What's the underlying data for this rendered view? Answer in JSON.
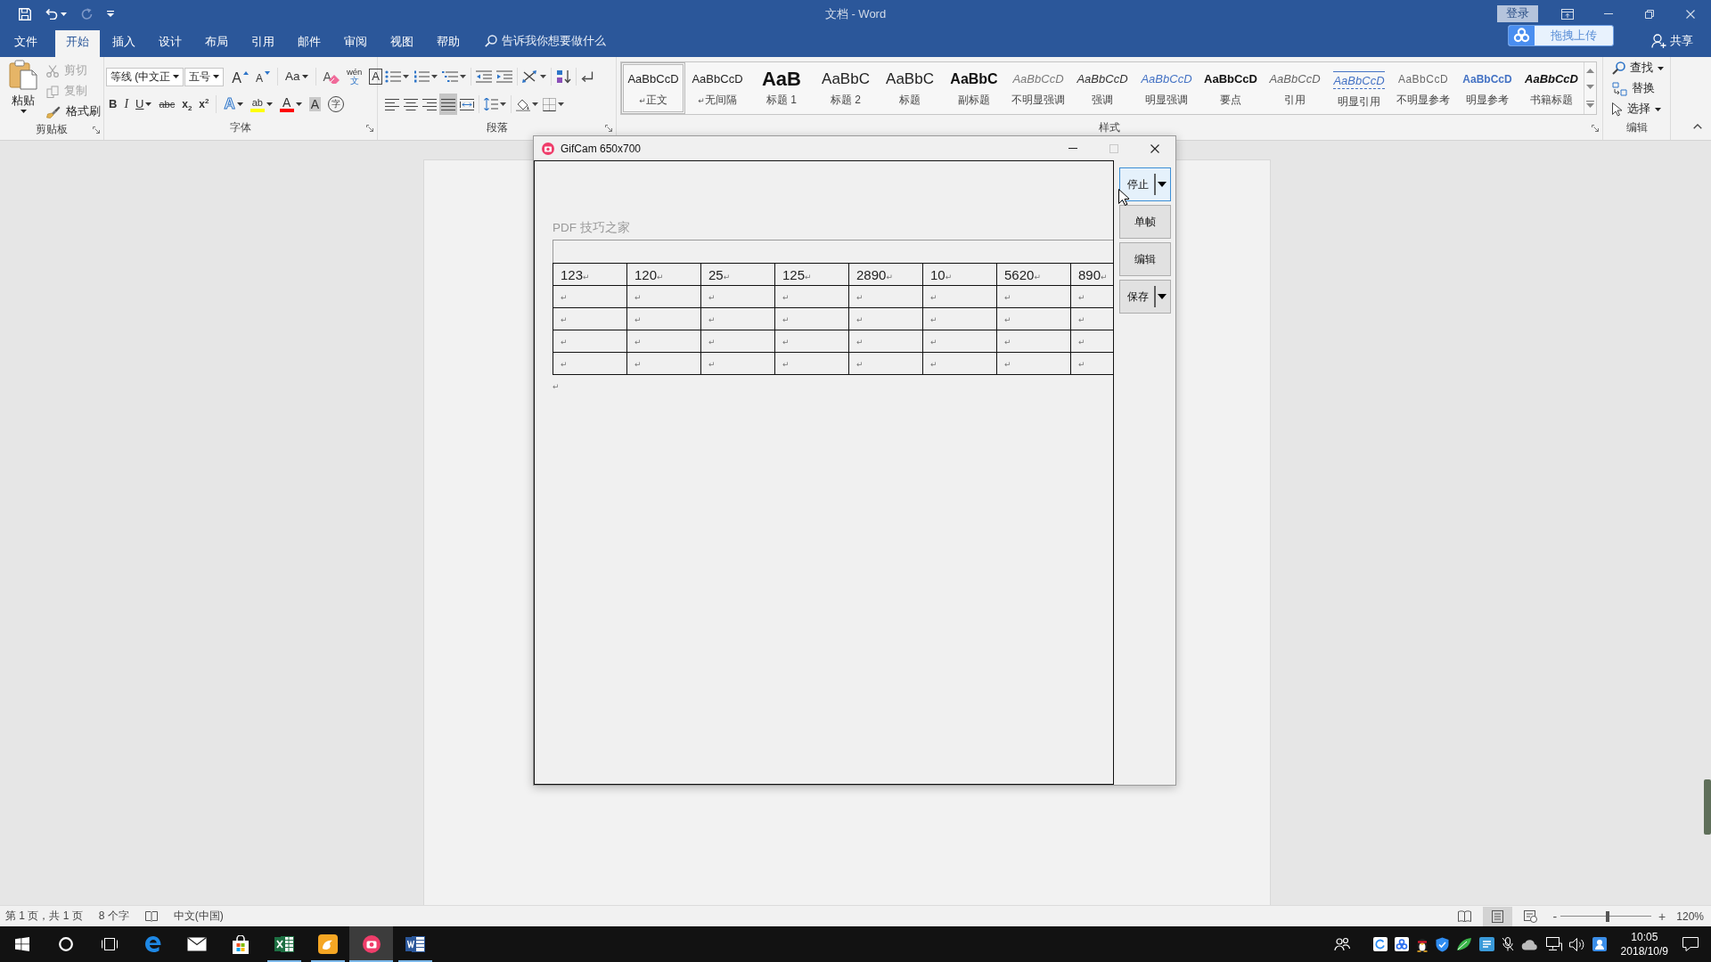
{
  "title_bar": {
    "quick_access": [
      {
        "kind": "save",
        "disabled": false,
        "dropdown": false
      },
      {
        "kind": "undo",
        "disabled": false,
        "dropdown": true
      },
      {
        "kind": "redo",
        "disabled": true,
        "dropdown": false
      },
      {
        "kind": "customize",
        "disabled": false,
        "dropdown": false
      }
    ],
    "title": "文档 - Word",
    "sign_in": "登录"
  },
  "menu_tabs": [
    {
      "label": "文件",
      "selected": false
    },
    {
      "label": "开始",
      "selected": true
    },
    {
      "label": "插入",
      "selected": false
    },
    {
      "label": "设计",
      "selected": false
    },
    {
      "label": "布局",
      "selected": false
    },
    {
      "label": "引用",
      "selected": false
    },
    {
      "label": "邮件",
      "selected": false
    },
    {
      "label": "审阅",
      "selected": false
    },
    {
      "label": "视图",
      "selected": false
    },
    {
      "label": "帮助",
      "selected": false
    }
  ],
  "tell_me": {
    "placeholder": "告诉我你想要做什么"
  },
  "upload_button": {
    "label": "拖拽上传"
  },
  "share_button": {
    "label": "共享"
  },
  "ribbon": {
    "clipboard": {
      "title": "剪贴板",
      "paste": "粘贴",
      "actions": [
        {
          "kind": "cut",
          "label": "剪切",
          "disabled": true
        },
        {
          "kind": "copy",
          "label": "复制",
          "disabled": true
        },
        {
          "kind": "format-painter",
          "label": "格式刷",
          "disabled": false
        }
      ]
    },
    "font": {
      "title": "字体",
      "font_name": "等线 (中文正",
      "font_size": "五号",
      "row_1": [
        {
          "kind": "grow",
          "label": "A",
          "dropdown": false
        },
        {
          "kind": "shrink",
          "label": "A",
          "dropdown": false
        },
        {
          "kind": "case",
          "label": "Aa",
          "dropdown": true
        },
        {
          "kind": "clear",
          "label": "A",
          "dropdown": false
        },
        {
          "kind": "phonetic",
          "label": "wén",
          "sub_label": "文",
          "dropdown": false
        },
        {
          "kind": "border",
          "label": "A",
          "dropdown": false
        }
      ],
      "row_2": [
        {
          "kind": "bold",
          "label": "B",
          "dropdown": false
        },
        {
          "kind": "italic",
          "label": "I",
          "dropdown": false
        },
        {
          "kind": "underline",
          "label": "U",
          "dropdown": true
        },
        {
          "kind": "strike",
          "label": "abc",
          "dropdown": false
        },
        {
          "kind": "subscript",
          "label": "x$_{2}$",
          "dropdown": false
        },
        {
          "kind": "superscript",
          "label": "x$^{2}$",
          "dropdown": false
        },
        {
          "kind": "effects",
          "label": "A",
          "dropdown": true
        },
        {
          "kind": "highlight",
          "label": "ab",
          "dropdown": true,
          "color": "#ffff00"
        },
        {
          "kind": "font-color",
          "label": "A",
          "dropdown": true,
          "color": "#ff0000"
        },
        {
          "kind": "shading",
          "label": "A",
          "dropdown": false
        },
        {
          "kind": "enclose",
          "label": "字",
          "dropdown": false
        }
      ]
    },
    "paragraph": {
      "title": "段落",
      "row_1": [
        {
          "kind": "bullets",
          "dropdown": true
        },
        {
          "kind": "numbering",
          "dropdown": true
        },
        {
          "kind": "multilevel",
          "dropdown": true
        },
        {
          "kind": "outdent",
          "dropdown": false
        },
        {
          "kind": "indent",
          "dropdown": false
        },
        {
          "kind": "asian-layout",
          "dropdown": true
        },
        {
          "kind": "sort",
          "dropdown": false
        },
        {
          "kind": "show-marks",
          "dropdown": false
        }
      ],
      "alignment": [
        {
          "kind": "align-left",
          "selected": false
        },
        {
          "kind": "align-center",
          "selected": false
        },
        {
          "kind": "align-right",
          "selected": false
        },
        {
          "kind": "justify",
          "selected": true
        },
        {
          "kind": "distributed",
          "selected": false
        }
      ],
      "row_2_tools": [
        {
          "kind": "line-spacing",
          "dropdown": true
        },
        {
          "kind": "para-shading",
          "dropdown": true
        },
        {
          "kind": "borders",
          "dropdown": true
        }
      ]
    },
    "styles": {
      "title": "样式",
      "items": [
        {
          "kind": "normal",
          "preview": "AaBbCcD",
          "name": "正文",
          "mark": "↵",
          "selected": true
        },
        {
          "kind": "normal",
          "preview": "AaBbCcD",
          "name": "无间隔",
          "mark": "↵",
          "selected": false
        },
        {
          "kind": "heading1",
          "preview": "AaB",
          "name": "标题 1",
          "selected": false
        },
        {
          "kind": "heading2",
          "preview": "AaBbC",
          "name": "标题 2",
          "selected": false
        },
        {
          "kind": "title",
          "preview": "AaBbC",
          "name": "标题",
          "selected": false
        },
        {
          "kind": "subtitle",
          "preview": "AaBbC",
          "name": "副标题",
          "selected": false
        },
        {
          "kind": "subtle-emphasis",
          "preview": "AaBbCcD",
          "name": "不明显强调",
          "selected": false
        },
        {
          "kind": "emphasis",
          "preview": "AaBbCcD",
          "name": "强调",
          "selected": false
        },
        {
          "kind": "intense-emphasis",
          "preview": "AaBbCcD",
          "name": "明显强调",
          "selected": false
        },
        {
          "kind": "strong",
          "preview": "AaBbCcD",
          "name": "要点",
          "selected": false
        },
        {
          "kind": "quote",
          "preview": "AaBbCcD",
          "name": "引用",
          "selected": false
        },
        {
          "kind": "intense-quote",
          "preview": "AaBbCcD",
          "name": "明显引用",
          "selected": false
        },
        {
          "kind": "subtle-reference",
          "preview": "AaBbCcD",
          "name": "不明显参考",
          "selected": false
        },
        {
          "kind": "intense-reference",
          "preview": "AaBbCcD",
          "name": "明显参考",
          "selected": false
        },
        {
          "kind": "book-title",
          "preview": "AaBbCcD",
          "name": "书籍标题",
          "selected": false
        }
      ]
    },
    "editing": {
      "title": "编辑",
      "actions": [
        {
          "kind": "find",
          "label": "查找",
          "dropdown": true
        },
        {
          "kind": "replace",
          "label": "替换",
          "dropdown": false
        },
        {
          "kind": "select",
          "label": "选择",
          "dropdown": true
        }
      ]
    }
  },
  "document": {
    "header": "PDF 技巧之家",
    "table": {
      "rows": [
        {
          "cells": [
            {
              "text": "123",
              "mark": "↵"
            },
            {
              "text": "120",
              "mark": "↵"
            },
            {
              "text": "25",
              "mark": "↵"
            },
            {
              "text": "125",
              "mark": "↵"
            },
            {
              "text": "2890",
              "mark": "↵"
            },
            {
              "text": "10",
              "mark": "↵"
            },
            {
              "text": "5620",
              "mark": "↵"
            },
            {
              "text": "890",
              "mark": "↵"
            }
          ]
        },
        {
          "cells": [
            {
              "mark": "↵"
            },
            {
              "mark": "↵"
            },
            {
              "mark": "↵"
            },
            {
              "mark": "↵"
            },
            {
              "mark": "↵"
            },
            {
              "mark": "↵"
            },
            {
              "mark": "↵"
            },
            {
              "mark": "↵"
            }
          ]
        },
        {
          "cells": [
            {
              "mark": "↵"
            },
            {
              "mark": "↵"
            },
            {
              "mark": "↵"
            },
            {
              "mark": "↵"
            },
            {
              "mark": "↵"
            },
            {
              "mark": "↵"
            },
            {
              "mark": "↵"
            },
            {
              "mark": "↵"
            }
          ]
        },
        {
          "cells": [
            {
              "mark": "↵"
            },
            {
              "mark": "↵"
            },
            {
              "mark": "↵"
            },
            {
              "mark": "↵"
            },
            {
              "mark": "↵"
            },
            {
              "mark": "↵"
            },
            {
              "mark": "↵"
            },
            {
              "mark": "↵"
            }
          ]
        },
        {
          "cells": [
            {
              "mark": "↵"
            },
            {
              "mark": "↵"
            },
            {
              "mark": "↵"
            },
            {
              "mark": "↵"
            },
            {
              "mark": "↵"
            },
            {
              "mark": "↵"
            },
            {
              "mark": "↵"
            },
            {
              "mark": "↵"
            }
          ]
        }
      ]
    },
    "end_mark": "↵"
  },
  "gifcam": {
    "title": "GifCam 650x700",
    "maximize_disabled": true,
    "buttons": [
      {
        "label": "停止",
        "dropdown": true,
        "highlighted": true
      },
      {
        "label": "单帧",
        "dropdown": false,
        "highlighted": false
      },
      {
        "label": "编辑",
        "dropdown": false,
        "highlighted": false
      },
      {
        "label": "保存",
        "dropdown": true,
        "highlighted": false
      }
    ]
  },
  "status_bar": {
    "page": "第 1 页，共 1 页",
    "words": "8 个字",
    "language": "中文(中国)",
    "views": [
      {
        "kind": "read",
        "selected": false
      },
      {
        "kind": "print",
        "selected": true
      },
      {
        "kind": "web",
        "selected": false
      }
    ],
    "zoom": {
      "minus": "-",
      "plus": "+",
      "level": 0.52,
      "value": "120%"
    }
  },
  "taskbar": {
    "items": [
      {
        "kind": "start",
        "running": false,
        "active": false
      },
      {
        "kind": "search",
        "running": false,
        "active": false
      },
      {
        "kind": "task-view",
        "running": false,
        "active": false
      },
      {
        "kind": "edge",
        "running": false,
        "active": false
      },
      {
        "kind": "mail",
        "running": false,
        "active": false
      },
      {
        "kind": "store",
        "running": false,
        "active": false
      },
      {
        "kind": "excel",
        "running": true,
        "active": false
      },
      {
        "kind": "uc",
        "running": true,
        "active": false
      },
      {
        "kind": "gifcam",
        "running": true,
        "active": true
      },
      {
        "kind": "word",
        "running": true,
        "active": false
      }
    ],
    "tray": [
      {
        "kind": "people"
      },
      {
        "kind": "sync"
      },
      {
        "kind": "rings"
      },
      {
        "kind": "penguin"
      },
      {
        "kind": "shield"
      },
      {
        "kind": "leaf"
      },
      {
        "kind": "list-tile"
      },
      {
        "kind": "mic"
      },
      {
        "kind": "cloud"
      },
      {
        "kind": "network"
      },
      {
        "kind": "volume"
      },
      {
        "kind": "contact"
      }
    ],
    "time": "10:05",
    "date": "2018/10/9"
  }
}
